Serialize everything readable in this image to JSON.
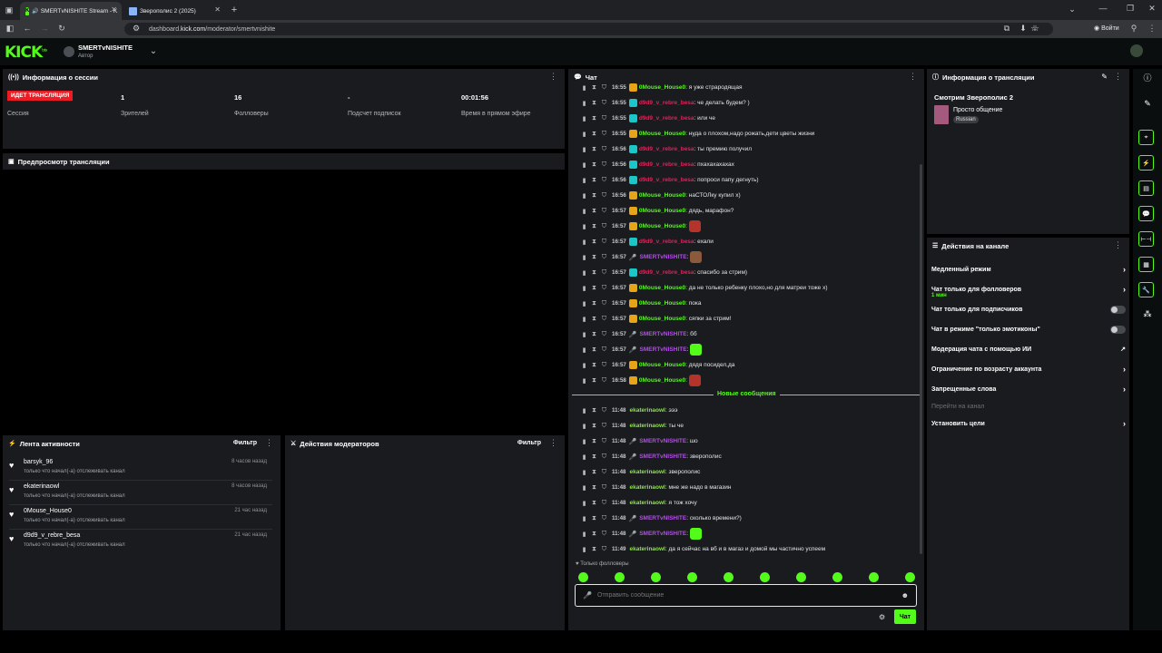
{
  "browser": {
    "tabs": [
      {
        "title": "SMERTvNISHITE Stream - K",
        "active": true
      },
      {
        "title": "Зверополис 2 (2025)",
        "active": false
      }
    ],
    "url_domain_prefix": "dashboard.",
    "url_domain": "kick.com",
    "url_path": "/moderator/smertvnishite",
    "profile_label": "Войти"
  },
  "header": {
    "logo": "KICK",
    "logo_tag": "beta",
    "channel_name": "SMERTvNISHITE",
    "channel_role": "Автор"
  },
  "session": {
    "title": "Информация о сессии",
    "live_badge": "ИДЕТ ТРАНСЛЯЦИЯ",
    "stats": [
      {
        "value": "1",
        "label": "Зрителей"
      },
      {
        "value": "16",
        "label": "Фолловеры"
      },
      {
        "value": "-",
        "label": "Подсчет подписок"
      },
      {
        "value": "00:01:56",
        "label": "Время в прямом эфире"
      }
    ],
    "session_label": "Сессия"
  },
  "preview": {
    "title": "Предпросмотр трансляции"
  },
  "activity": {
    "title": "Лента активности",
    "filter": "Фильтр",
    "items": [
      {
        "name": "barsyk_96",
        "sub": "только что начал(-а) отслеживать канал",
        "time": "8 часов назад"
      },
      {
        "name": "ekaterinaowl",
        "sub": "только что начал(-а) отслеживать канал",
        "time": "8 часов назад"
      },
      {
        "name": "0Mouse_House0",
        "sub": "только что начал(-а) отслеживать канал",
        "time": "21 час назад"
      },
      {
        "name": "d9d9_v_rebre_besa",
        "sub": "только что начал(-а) отслеживать канал",
        "time": "21 час назад"
      }
    ]
  },
  "modactions": {
    "title": "Действия модераторов",
    "filter": "Фильтр"
  },
  "chat": {
    "title": "Чат",
    "new_messages": "Новые сообщения",
    "followers_only": "Только фолловеры",
    "input_placeholder": "Отправить сообщение",
    "send_button": "Чат",
    "messages_old": [
      {
        "time": "16:55",
        "user": "0Mouse_House0",
        "color": "#53fc18",
        "text": ": я уже страродящая",
        "badge": "#e8a317"
      },
      {
        "time": "16:55",
        "user": "d9d9_v_rebre_besa",
        "color": "#d9265b",
        "text": ": че делать будем? )",
        "badge": "#1bc6c9"
      },
      {
        "time": "16:55",
        "user": "d9d9_v_rebre_besa",
        "color": "#d9265b",
        "text": ": или че",
        "badge": "#1bc6c9"
      },
      {
        "time": "16:55",
        "user": "0Mouse_House0",
        "color": "#53fc18",
        "text": ": нуда о плохом,надо рожать,дети цветы жизни",
        "badge": "#e8a317"
      },
      {
        "time": "16:56",
        "user": "d9d9_v_rebre_besa",
        "color": "#d9265b",
        "text": ": ты премию получил",
        "badge": "#1bc6c9"
      },
      {
        "time": "16:56",
        "user": "d9d9_v_rebre_besa",
        "color": "#d9265b",
        "text": ": пхахахахахах",
        "badge": "#1bc6c9"
      },
      {
        "time": "16:56",
        "user": "d9d9_v_rebre_besa",
        "color": "#d9265b",
        "text": ": попроси папу дегнуть)",
        "badge": "#1bc6c9"
      },
      {
        "time": "16:56",
        "user": "0Mouse_House0",
        "color": "#53fc18",
        "text": ": наСТОЛку купил х)",
        "badge": "#e8a317"
      },
      {
        "time": "16:57",
        "user": "0Mouse_House0",
        "color": "#53fc18",
        "text": ": дядь, марафон?",
        "badge": "#e8a317"
      },
      {
        "time": "16:57",
        "user": "0Mouse_House0",
        "color": "#53fc18",
        "text": ":",
        "badge": "#e8a317",
        "emote": "#b5332a"
      },
      {
        "time": "16:57",
        "user": "d9d9_v_rebre_besa",
        "color": "#d9265b",
        "text": ": ехали",
        "badge": "#1bc6c9"
      },
      {
        "time": "16:57",
        "user": "SMERTvNISHITE",
        "color": "#b44de8",
        "text": ":",
        "badge": "mic",
        "emote": "#8b5a3c"
      },
      {
        "time": "16:57",
        "user": "d9d9_v_rebre_besa",
        "color": "#d9265b",
        "text": ": спасибо за стрим)",
        "badge": "#1bc6c9"
      },
      {
        "time": "16:57",
        "user": "0Mouse_House0",
        "color": "#53fc18",
        "text": ": да не только ребенку плохо,но для матреи тоже х)",
        "badge": "#e8a317"
      },
      {
        "time": "16:57",
        "user": "0Mouse_House0",
        "color": "#53fc18",
        "text": ": пока",
        "badge": "#e8a317"
      },
      {
        "time": "16:57",
        "user": "0Mouse_House0",
        "color": "#53fc18",
        "text": ": сяпки за стрим!",
        "badge": "#e8a317"
      },
      {
        "time": "16:57",
        "user": "SMERTvNISHITE",
        "color": "#b44de8",
        "text": ": бб",
        "badge": "mic"
      },
      {
        "time": "16:57",
        "user": "SMERTvNISHITE",
        "color": "#b44de8",
        "text": ":",
        "badge": "mic",
        "emote": "#53fc18"
      },
      {
        "time": "16:57",
        "user": "0Mouse_House0",
        "color": "#53fc18",
        "text": ": дядя посидел,да",
        "badge": "#e8a317"
      },
      {
        "time": "16:58",
        "user": "0Mouse_House0",
        "color": "#53fc18",
        "text": ":",
        "badge": "#e8a317",
        "emote": "#b5332a"
      }
    ],
    "messages_new": [
      {
        "time": "11:48",
        "user": "ekaterinaowl",
        "color": "#8be44a",
        "text": ": эээ",
        "badge": ""
      },
      {
        "time": "11:48",
        "user": "ekaterinaowl",
        "color": "#8be44a",
        "text": ": ты че",
        "badge": ""
      },
      {
        "time": "11:48",
        "user": "SMERTvNISHITE",
        "color": "#b44de8",
        "text": ": шо",
        "badge": "mic"
      },
      {
        "time": "11:48",
        "user": "SMERTvNISHITE",
        "color": "#b44de8",
        "text": ": зверополис",
        "badge": "mic"
      },
      {
        "time": "11:48",
        "user": "ekaterinaowl",
        "color": "#8be44a",
        "text": ": зверополис",
        "badge": ""
      },
      {
        "time": "11:48",
        "user": "ekaterinaowl",
        "color": "#8be44a",
        "text": ": мне же надо в магазин",
        "badge": ""
      },
      {
        "time": "11:48",
        "user": "ekaterinaowl",
        "color": "#8be44a",
        "text": ": я тож хочу",
        "badge": ""
      },
      {
        "time": "11:48",
        "user": "SMERTvNISHITE",
        "color": "#b44de8",
        "text": ": сколько времени?)",
        "badge": "mic"
      },
      {
        "time": "11:48",
        "user": "SMERTvNISHITE",
        "color": "#b44de8",
        "text": ":",
        "badge": "mic",
        "emote": "#53fc18"
      },
      {
        "time": "11:49",
        "user": "ekaterinaowl",
        "color": "#8be44a",
        "text": ": да я сейчас на вб и в магаз и домой мы частично успеем",
        "badge": ""
      }
    ]
  },
  "stream_info": {
    "title": "Информация о трансляции",
    "stream_title": "Смотрим Зверополис 2",
    "category": "Просто общение",
    "language": "Russian"
  },
  "channel_actions": {
    "title": "Действия на канале",
    "items": [
      {
        "label": "Медленный режим",
        "sub": "",
        "control": "arrow"
      },
      {
        "label": "Чат только для фолловеров",
        "sub": "1 мин",
        "control": "arrow"
      },
      {
        "label": "Чат только для подписчиков",
        "sub": "",
        "control": "toggle"
      },
      {
        "label": "Чат в режиме \"только эмотиконы\"",
        "sub": "",
        "control": "toggle"
      },
      {
        "label": "Модерация чата с помощью ИИ",
        "sub": "",
        "control": "external"
      },
      {
        "label": "Ограничение по возрасту аккаунта",
        "sub": "",
        "control": "arrow"
      },
      {
        "label": "Запрещенные слова",
        "sub": "",
        "control": "arrow"
      },
      {
        "label": "Перейти на канал",
        "sub": "",
        "control": "disabled"
      },
      {
        "label": "Установить цели",
        "sub": "",
        "control": "arrow"
      }
    ]
  },
  "colors": {
    "accent": "#53fc18",
    "live": "#ec1c24",
    "panel": "#191b1f"
  }
}
